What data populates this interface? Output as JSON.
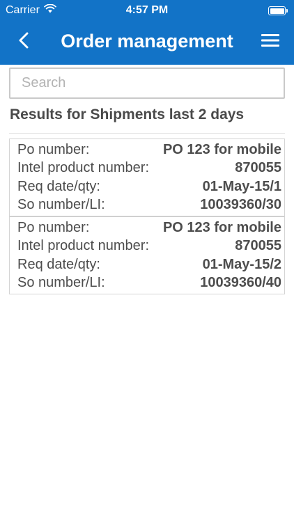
{
  "status_bar": {
    "carrier": "Carrier",
    "time": "4:57 PM"
  },
  "nav": {
    "title": "Order management",
    "back_icon": "chevron-left-icon",
    "menu_icon": "hamburger-menu-icon"
  },
  "search": {
    "placeholder": "Search",
    "value": ""
  },
  "results": {
    "heading": "Results for Shipments last 2 days",
    "items": [
      {
        "po_label": "Po number:",
        "po_value": "PO 123 for mobile",
        "product_label": "Intel product number:",
        "product_value": "870055",
        "req_label": "Req date/qty:",
        "req_value": "01-May-15/1",
        "so_label": "So number/LI:",
        "so_value": "10039360/30"
      },
      {
        "po_label": "Po number:",
        "po_value": "PO 123 for mobile",
        "product_label": "Intel product number:",
        "product_value": "870055",
        "req_label": "Req date/qty:",
        "req_value": "01-May-15/2",
        "so_label": "So number/LI:",
        "so_value": "10039360/40"
      }
    ]
  },
  "colors": {
    "header_bg": "#1273c7",
    "text": "#4d4d4d",
    "border": "#d4d4d4"
  }
}
